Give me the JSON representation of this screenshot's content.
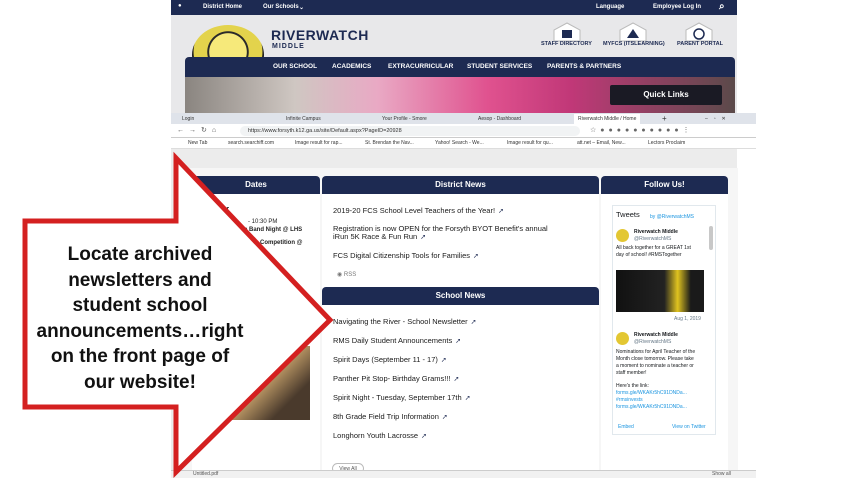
{
  "utility_bar": {
    "district_home": "District Home",
    "our_schools": "Our Schools",
    "language": "Language",
    "employee_login": "Employee Log In"
  },
  "school": {
    "name": "RIVERWATCH",
    "subtitle": "MIDDLE"
  },
  "header_links": [
    "STAFF DIRECTORY",
    "MYFCS (ITSLEARNING)",
    "PARENT PORTAL"
  ],
  "nav": [
    "OUR SCHOOL",
    "ACADEMICS",
    "EXTRACURRICULAR",
    "STUDENT SERVICES",
    "PARENTS & PARTNERS"
  ],
  "quick_links": "Quick Links",
  "browser": {
    "tabs": [
      "Login",
      "Infinite Campus",
      "Your Profile - Smore",
      "Aesop - Dashboard",
      "Riverwatch Middle / Home"
    ],
    "url": "https://www.forsyth.k12.ga.us/site/Default.aspx?PageID=20928",
    "bookmarks": [
      "New Tab",
      "search.searchiff.com",
      "Image result for rap...",
      "St. Brendan the Nav...",
      "Yahoo! Search - We...",
      "Image result for qu...",
      "att.net – Email, New...",
      "Lectors Proclaim"
    ]
  },
  "columns": {
    "dates": "Dates",
    "district_news": "District News",
    "follow_us": "Follow Us!",
    "school_news": "School News"
  },
  "dates_fragments": [
    "mber",
    "- 10:30 PM",
    "e Band Night @ LHS",
    "Competition @"
  ],
  "district_news": [
    "2019-20 FCS School Level Teachers of the Year!",
    "Registration is now OPEN for the Forsyth BYOT Benefit's annual",
    "iRun 5K Race & Fun Run",
    "FCS Digital Citizenship Tools for Families"
  ],
  "rss": "RSS",
  "school_news": [
    "Navigating the River - School Newsletter",
    "RMS Daily Student Announcements",
    "Spirit Days (September 11 - 17)",
    "Panther Pit Stop- Birthday Grams!!!",
    "Spirit Night - Tuesday, September 17th",
    "8th Grade Field Trip Information",
    "Longhorn Youth Lacrosse"
  ],
  "view_all": "View All",
  "twitter": {
    "title": "Tweets",
    "by": "by @RiverwatchMS",
    "account_name": "Riverwatch Middle",
    "handle": "@RiverwatchMS",
    "tweet1": [
      "All back together for a GREAT 1st",
      "day of school! #RMSTogether"
    ],
    "date": "Aug 1, 2019",
    "tweet2": [
      "Nominations for April Teacher of the",
      "Month close tomorrow. Please take",
      "a moment to nominate a teacher or",
      "staff member!",
      "",
      "Here's the link:",
      "forms.gle/WKAKr5hC91DNDa...",
      "#rmsinvests",
      "forms.gle/WKAKr5hC91DNDa..."
    ],
    "embed": "Embed",
    "view_on_twitter": "View on Twitter"
  },
  "callout_lines": [
    "Locate archived",
    "newsletters and",
    "student school",
    "announcements…right",
    "on the front page of",
    "our website!"
  ],
  "download_bar": {
    "file": "Untitled.pdf",
    "show_all": "Show all"
  },
  "colors": {
    "navy": "#1d2a52",
    "callout_red": "#d42020"
  }
}
